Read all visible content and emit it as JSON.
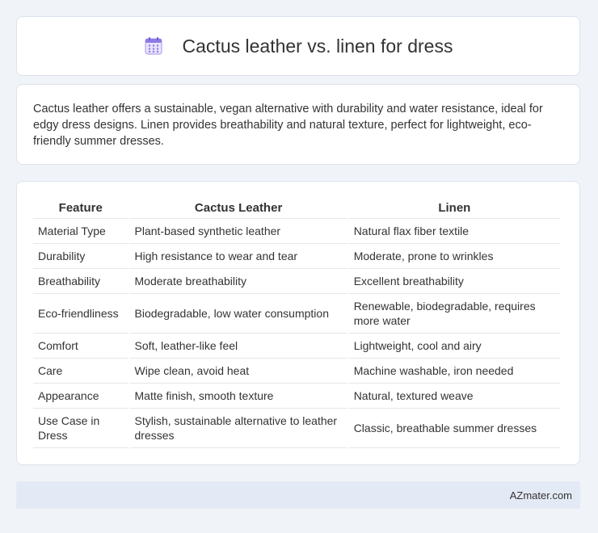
{
  "header": {
    "title": "Cactus leather vs. linen for dress",
    "icon": "calendar-icon"
  },
  "summary": {
    "text": "Cactus leather offers a sustainable, vegan alternative with durability and water resistance, ideal for edgy dress designs. Linen provides breathability and natural texture, perfect for lightweight, eco-friendly summer dresses."
  },
  "table": {
    "headers": [
      "Feature",
      "Cactus Leather",
      "Linen"
    ],
    "rows": [
      [
        "Material Type",
        "Plant-based synthetic leather",
        "Natural flax fiber textile"
      ],
      [
        "Durability",
        "High resistance to wear and tear",
        "Moderate, prone to wrinkles"
      ],
      [
        "Breathability",
        "Moderate breathability",
        "Excellent breathability"
      ],
      [
        "Eco-friendliness",
        "Biodegradable, low water consumption",
        "Renewable, biodegradable, requires more water"
      ],
      [
        "Comfort",
        "Soft, leather-like feel",
        "Lightweight, cool and airy"
      ],
      [
        "Care",
        "Wipe clean, avoid heat",
        "Machine washable, iron needed"
      ],
      [
        "Appearance",
        "Matte finish, smooth texture",
        "Natural, textured weave"
      ],
      [
        "Use Case in Dress",
        "Stylish, sustainable alternative to leather dresses",
        "Classic, breathable summer dresses"
      ]
    ]
  },
  "footer": {
    "brand": "AZmater.com"
  },
  "colors": {
    "background": "#f0f3f8",
    "card": "#ffffff",
    "footer_bg": "#e4eaf5",
    "icon_accent": "#8f7ae6"
  }
}
